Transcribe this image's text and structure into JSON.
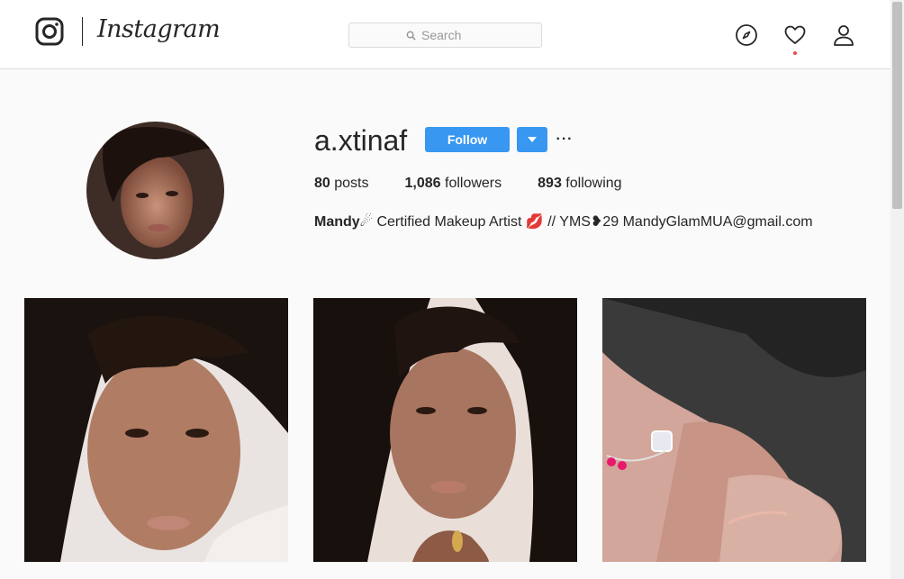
{
  "nav": {
    "brand": "Instagram",
    "search_placeholder": "Search",
    "icons": [
      "instagram-glyph-icon",
      "explore-compass-icon",
      "activity-heart-icon",
      "profile-person-icon"
    ],
    "notification_dot_color": "#ed4956"
  },
  "profile": {
    "username": "a.xtinaf",
    "follow_label": "Follow",
    "more_label": "···",
    "stats": {
      "posts_count": "80",
      "posts_label": "posts",
      "followers_count": "1,086",
      "followers_label": "followers",
      "following_count": "893",
      "following_label": "following"
    },
    "bio": {
      "name": "Mandy",
      "text": "☄ Certified Makeup Artist 💋 // YMS❥29 MandyGlamMUA@gmail.com"
    }
  },
  "colors": {
    "accent": "#3897f0",
    "text": "#262626",
    "border": "#dbdbdb",
    "background": "#fafafa"
  }
}
